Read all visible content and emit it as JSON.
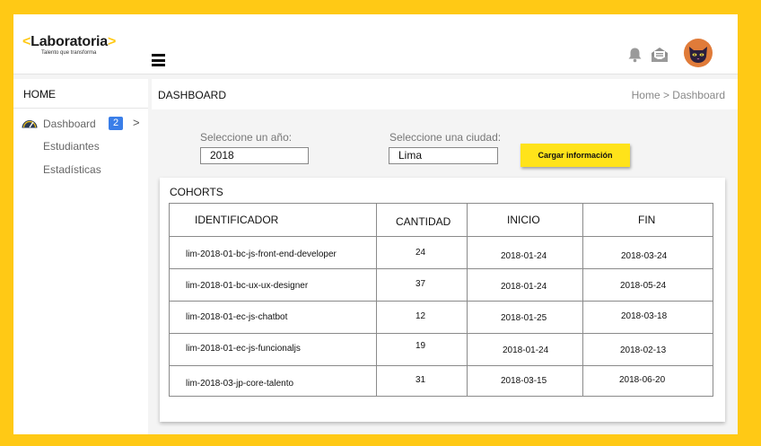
{
  "brand": {
    "logo_bracket_left": "<",
    "logo_name": "Laboratoria",
    "logo_bracket_right": ">",
    "tagline": "Talento que transforma",
    "accent_color": "#FFC915"
  },
  "topbar": {
    "menu_icon": "hamburger-icon",
    "notifications_icon": "bell-icon",
    "messages_icon": "mail-icon",
    "avatar_icon": "cat-avatar"
  },
  "sidebar": {
    "title": "HOME",
    "items": [
      {
        "label": "Dashboard",
        "badge": "2",
        "chevron": ">",
        "icon": "gauge-icon"
      },
      {
        "label": "Estudiantes"
      },
      {
        "label": "Estadísticas"
      }
    ]
  },
  "header": {
    "title": "DASHBOARD",
    "breadcrumb": "Home > Dashboard"
  },
  "filters": {
    "year_label": "Seleccione un año:",
    "year_value": "2018",
    "city_label": "Seleccione una ciudad:",
    "city_value": "Lima",
    "load_button": "Cargar información"
  },
  "cohorts": {
    "title": "COHORTS",
    "columns": [
      "IDENTIFICADOR",
      "CANTIDAD",
      "INICIO",
      "FIN"
    ],
    "rows": [
      [
        "lim-2018-01-bc-js-front-end-developer",
        "24",
        "2018-01-24",
        "2018-03-24"
      ],
      [
        "lim-2018-01-bc-ux-ux-designer",
        "37",
        "2018-01-24",
        "2018-05-24"
      ],
      [
        "lim-2018-01-ec-js-chatbot",
        "12",
        "2018-01-25",
        "2018-03-18"
      ],
      [
        "lim-2018-01-ec-js-funcionaljs",
        "19",
        "2018-01-24",
        "2018-02-13"
      ],
      [
        "lim-2018-03-jp-core-talento",
        "31",
        "2018-03-15",
        "2018-06-20"
      ]
    ]
  }
}
